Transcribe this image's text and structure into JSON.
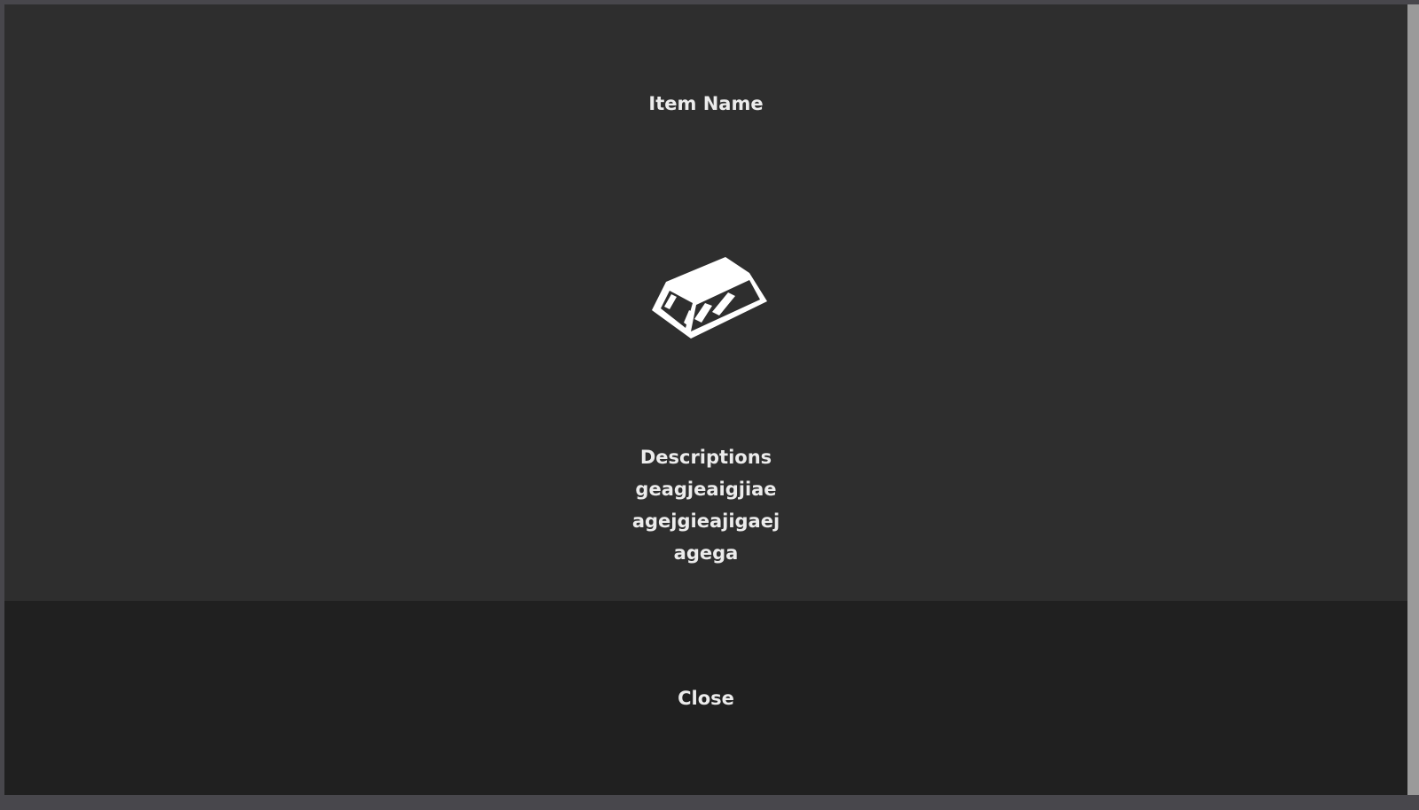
{
  "dialog": {
    "title": "Item Name",
    "icon": "gold-bar-icon",
    "description_lines": [
      "Descriptions",
      "geagjeaigjiae",
      "agejgieajigaej",
      "agega"
    ],
    "close_label": "Close"
  },
  "colors": {
    "panel_background": "#2e2e2e",
    "footer_background": "#202020",
    "text": "#ececec",
    "outer_background": "#48474c"
  }
}
